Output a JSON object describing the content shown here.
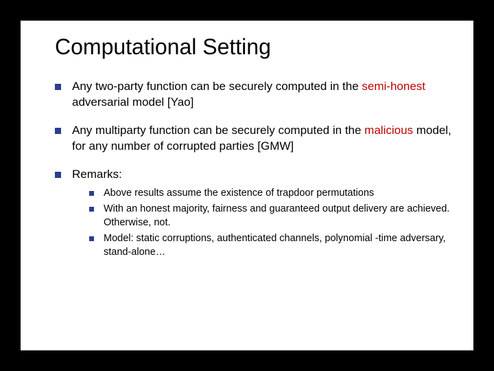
{
  "title": "Computational Setting",
  "bullets": {
    "b1": {
      "pre": "Any two-party function can be securely computed in the ",
      "red": "semi-honest",
      "post": " adversarial model [Yao]"
    },
    "b2": {
      "pre": "Any multiparty function can be securely computed  in the ",
      "red": "malicious",
      "post": " model, for any number of corrupted parties [GMW]"
    },
    "b3": {
      "text": "Remarks:"
    }
  },
  "sub": {
    "s1": "Above results assume the existence of trapdoor permutations",
    "s2": "With an honest majority, fairness and guaranteed output delivery are achieved. Otherwise, not.",
    "s3": "Model: static corruptions, authenticated channels, polynomial -time adversary, stand-alone…"
  }
}
